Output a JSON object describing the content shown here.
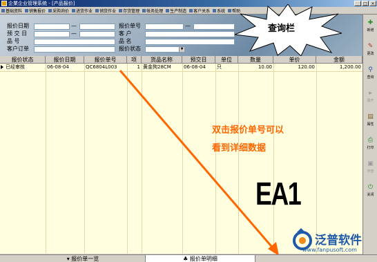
{
  "window": {
    "title": "企業企业管理系统 - [产品报价]"
  },
  "menu": [
    {
      "label": "基础资料"
    },
    {
      "label": "销售报价"
    },
    {
      "label": "采购询价"
    },
    {
      "label": "进货作业"
    },
    {
      "label": "销货作业"
    },
    {
      "label": "存货管理"
    },
    {
      "label": "帐务处理"
    },
    {
      "label": "生产制造"
    },
    {
      "label": "客户关系"
    },
    {
      "label": "系统"
    },
    {
      "label": "帮助"
    }
  ],
  "query": {
    "quote_date_label": "报价日期",
    "pre_delivery_label": "预 交 日",
    "product_no_label": "品     号",
    "customer_order_label": "客户订单",
    "quote_no_label": "报价单号",
    "customer_label": "客     户",
    "product_name_label": "品     名",
    "quote_status_label": "报价状态",
    "dash": "—",
    "combo_arrow": "▼"
  },
  "callout": {
    "label": "查询栏"
  },
  "grid": {
    "columns": [
      "报价状态",
      "报价日期",
      "报价单号",
      "项",
      "货品名称",
      "预交日",
      "单位",
      "数量",
      "单价",
      "金额"
    ],
    "rows": [
      [
        "已经审核",
        "06-08-04",
        "QC6804L003",
        "1",
        "黄金狗28CM",
        "06-08-04",
        "只",
        "10.00",
        "120.00",
        "1,200.00"
      ]
    ]
  },
  "annotations": {
    "line1": "双击报价单号可以",
    "line2": "看到详细数据",
    "code": "EA1"
  },
  "logo": {
    "name": "泛普软件",
    "url": "www.fanpusoft.com"
  },
  "tabs": {
    "list_tab": "报价单一览",
    "detail_tab": "报价单明细"
  },
  "toolbar": [
    {
      "label": "新增",
      "icon": "new-icon",
      "glyph": "✚",
      "enabled": true
    },
    {
      "label": "更改",
      "icon": "edit-icon",
      "glyph": "✎",
      "enabled": true
    },
    {
      "label": "查询",
      "icon": "query-icon",
      "glyph": "⚲",
      "enabled": true
    },
    {
      "label": "展开",
      "icon": "expand-icon",
      "glyph": "▸",
      "enabled": false
    },
    {
      "label": "属性",
      "icon": "properties-icon",
      "glyph": "▤",
      "enabled": true
    },
    {
      "label": "打印",
      "icon": "print-icon",
      "glyph": "⎙",
      "enabled": true
    },
    {
      "label": "存盘",
      "icon": "save-icon",
      "glyph": "▣",
      "enabled": false
    },
    {
      "label": "关闭",
      "icon": "close-icon",
      "glyph": "⏻",
      "enabled": true
    }
  ],
  "colors": {
    "grid_bg": "#ffffe0",
    "annotation": "#ff6600",
    "arrow": "#ff6600",
    "logo": "#1e5aa8"
  }
}
